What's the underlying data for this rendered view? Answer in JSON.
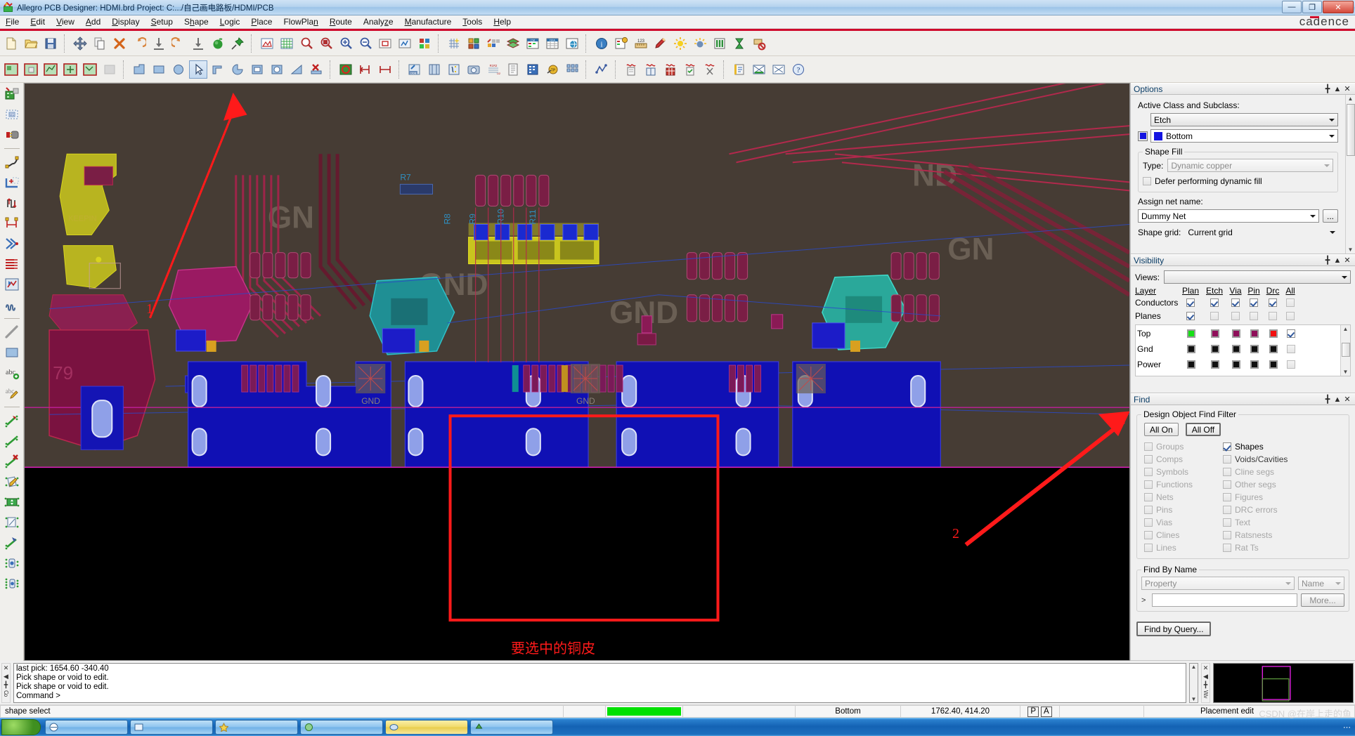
{
  "window": {
    "title": "Allegro PCB Designer: HDMI.brd  Project: C:.../自己画电路板/HDMI/PCB",
    "minimize_label": "—",
    "maximize_label": "❐",
    "close_label": "✕",
    "brand": "cadence"
  },
  "menubar": {
    "items": [
      {
        "label": "File",
        "mnemonic": "F"
      },
      {
        "label": "Edit",
        "mnemonic": "E"
      },
      {
        "label": "View",
        "mnemonic": "V"
      },
      {
        "label": "Add",
        "mnemonic": "A"
      },
      {
        "label": "Display",
        "mnemonic": "D"
      },
      {
        "label": "Setup",
        "mnemonic": "S"
      },
      {
        "label": "Shape",
        "mnemonic": "h"
      },
      {
        "label": "Logic",
        "mnemonic": "L"
      },
      {
        "label": "Place",
        "mnemonic": "P"
      },
      {
        "label": "FlowPlan",
        "mnemonic": "n"
      },
      {
        "label": "Route",
        "mnemonic": "R"
      },
      {
        "label": "Analyze",
        "mnemonic": "z"
      },
      {
        "label": "Manufacture",
        "mnemonic": "M"
      },
      {
        "label": "Tools",
        "mnemonic": "T"
      },
      {
        "label": "Help",
        "mnemonic": "H"
      }
    ]
  },
  "toolbar_primary": {
    "groups": [
      [
        "new-file-icon",
        "open-folder-icon",
        "save-icon"
      ],
      [
        "move-icon",
        "copy-icon",
        "delete-icon",
        "undo-icon",
        "import-down-icon",
        "redo-icon",
        "export-down-icon",
        "green-sphere-icon",
        "pushpin-icon"
      ],
      [
        "display-color-icon",
        "grid-toggle-icon",
        "zoom-in-icon",
        "zoom-out-icon",
        "zoom-fit-icon",
        "zoom-previous-icon",
        "zoom-world-icon",
        "redraw-icon",
        "color192-icon"
      ],
      [
        "grid-sparkle-icon",
        "placement-icon",
        "quickplace-icon",
        "layers-icon",
        "constraint-manager-icon",
        "dfa-icon",
        "global-icon"
      ],
      [
        "info-icon",
        "property-icon",
        "measure-123-icon",
        "highlight-brush-icon",
        "dehighlight-icon",
        "shadow-icon",
        "layer-bars-icon",
        "hourglass-icon",
        "stop-icon"
      ]
    ]
  },
  "toolbar_secondary": {
    "groups": [
      [
        "shape-add-rect-icon",
        "shape-add-circle-icon",
        "shape-polygon-icon",
        "shape-select-icon",
        "shape-edit-icon",
        "shape-blank-icon"
      ],
      [
        "draw-polygon-icon",
        "draw-rectangle-icon",
        "draw-circle-icon",
        "arrow-select-icon",
        "shape-compose-icon",
        "shape-pie-icon",
        "shape-rect2-icon",
        "shape-circle2-icon",
        "shape-merge-icon",
        "shape-delete-icon"
      ],
      [
        "drc-board-icon",
        "dim-left-icon",
        "dim-lr-icon"
      ],
      [
        "odb-export-icon",
        "film-icon",
        "drill-legend-icon",
        "camera-icon",
        "silkscreen-icon",
        "reports-icon",
        "bom-icon",
        "testprep-icon",
        "array-icon"
      ],
      [
        "signal-integrity-icon"
      ],
      [
        "waveform-report-icon",
        "waveform-book-icon",
        "waveform-table-icon",
        "waveform-check-icon",
        "waveform-clip-icon"
      ],
      [
        "status-icon",
        "cross-probe-icon",
        "window-icon",
        "help-icon"
      ]
    ]
  },
  "left_toolbar": {
    "groups": [
      [
        "place-manual-icon",
        "placement-edit-icon",
        "swap-icon"
      ],
      [
        "add-connect-icon",
        "slide-icon",
        "delay-tune-icon",
        "route-vertex-icon",
        "fanout-icon",
        "bus-route-icon",
        "auto-interactive-icon",
        "meander-icon"
      ],
      [
        "add-line-icon",
        "add-rect-icon",
        "add-text-icon",
        "edit-text-icon"
      ],
      [
        "net-hilite-icon",
        "net-line-icon",
        "net-delete-icon",
        "net-edit-icon",
        "net-move-icon",
        "net-copy-icon",
        "net-slide-icon",
        "net-via-icon",
        "net-vias-icon"
      ]
    ]
  },
  "options_panel": {
    "title": "Options",
    "active_class_label": "Active Class and Subclass:",
    "class_value": "Etch",
    "subclass_value": "Bottom",
    "subclass_color": "#1414e1",
    "shape_fill_legend": "Shape Fill",
    "type_label": "Type:",
    "type_value": "Dynamic copper",
    "defer_label": "Defer performing dynamic fill",
    "defer_checked": false,
    "assign_net_label": "Assign net name:",
    "net_value": "Dummy Net",
    "net_browse_label": "...",
    "shape_grid_label": "Shape grid:",
    "shape_grid_value": "Current grid"
  },
  "visibility_panel": {
    "title": "Visibility",
    "views_label": "Views:",
    "views_value": "",
    "columns": [
      "Plan",
      "Etch",
      "Via",
      "Pin",
      "Drc",
      "All"
    ],
    "layer_header": "Layer",
    "rows": [
      {
        "name": "Conductors",
        "plan": true,
        "etch": true,
        "via": true,
        "pin": true,
        "drc": true,
        "all": false
      },
      {
        "name": "Planes",
        "plan": true,
        "etch": false,
        "via": false,
        "pin": false,
        "drc": false,
        "all": false
      }
    ],
    "layers": [
      {
        "name": "Top",
        "colors": [
          "#15e015",
          "#8f0f5a",
          "#8f0f5a",
          "#8f0f5a",
          "#f21010"
        ],
        "all": true
      },
      {
        "name": "Gnd",
        "colors": [
          "#101010",
          "#101010",
          "#101010",
          "#101010",
          "#101010"
        ],
        "all": false
      },
      {
        "name": "Power",
        "colors": [
          "#101010",
          "#101010",
          "#101010",
          "#101010",
          "#101010"
        ],
        "all": false
      }
    ]
  },
  "find_panel": {
    "title": "Find",
    "filter_legend": "Design Object Find Filter",
    "all_on_label": "All On",
    "all_off_label": "All Off",
    "left_column": [
      {
        "label": "Groups",
        "checked": false,
        "dim": true
      },
      {
        "label": "Comps",
        "checked": false,
        "dim": true
      },
      {
        "label": "Symbols",
        "checked": false,
        "dim": true
      },
      {
        "label": "Functions",
        "checked": false,
        "dim": true
      },
      {
        "label": "Nets",
        "checked": false,
        "dim": true
      },
      {
        "label": "Pins",
        "checked": false,
        "dim": true
      },
      {
        "label": "Vias",
        "checked": false,
        "dim": true
      },
      {
        "label": "Clines",
        "checked": false,
        "dim": true
      },
      {
        "label": "Lines",
        "checked": false,
        "dim": true
      }
    ],
    "right_column": [
      {
        "label": "Shapes",
        "checked": true,
        "dim": false
      },
      {
        "label": "Voids/Cavities",
        "checked": false,
        "dim": true
      },
      {
        "label": "Cline segs",
        "checked": false,
        "dim": true
      },
      {
        "label": "Other segs",
        "checked": false,
        "dim": true
      },
      {
        "label": "Figures",
        "checked": false,
        "dim": true
      },
      {
        "label": "DRC errors",
        "checked": false,
        "dim": true
      },
      {
        "label": "Text",
        "checked": false,
        "dim": true
      },
      {
        "label": "Ratsnests",
        "checked": false,
        "dim": true
      },
      {
        "label": "Rat Ts",
        "checked": false,
        "dim": true
      }
    ],
    "find_by_name_legend": "Find By Name",
    "property_value": "Property",
    "name_value": "Name",
    "name_input_value": "",
    "more_label": "More...",
    "find_by_query_label": "Find by Query..."
  },
  "console": {
    "lines": [
      "last pick:  1654.60 -340.40",
      "Pick shape or void to edit.",
      "Pick shape or void to edit.",
      "Command >"
    ],
    "dock_icons": [
      "close-icon",
      "collapse-icon",
      "pin-icon",
      "console-label"
    ],
    "worldview_label": "W.v"
  },
  "statusbar": {
    "mode": "shape select",
    "layer": "Bottom",
    "coordinates": "1762.40, 414.20",
    "p_label": "P",
    "a_label": "A",
    "right_text": "Placement edit",
    "indicator_color": "#00e000"
  },
  "annotations": {
    "num1": "1",
    "num2": "2",
    "chinese_caption": "要选中的铜皮",
    "accent": "#ff1a1a"
  },
  "canvas": {
    "net_labels": [
      "GND",
      "GND",
      "GND",
      "GND",
      "GND"
    ],
    "ref_designators": [
      "R7",
      "R8",
      "R9",
      "R10",
      "R11"
    ],
    "background": "#000000",
    "copper_fill": "#463c34"
  },
  "taskbar": {
    "items": [
      "",
      "",
      "",
      "",
      ""
    ],
    "watermark": "CSDN @在岸上走的鱼"
  }
}
